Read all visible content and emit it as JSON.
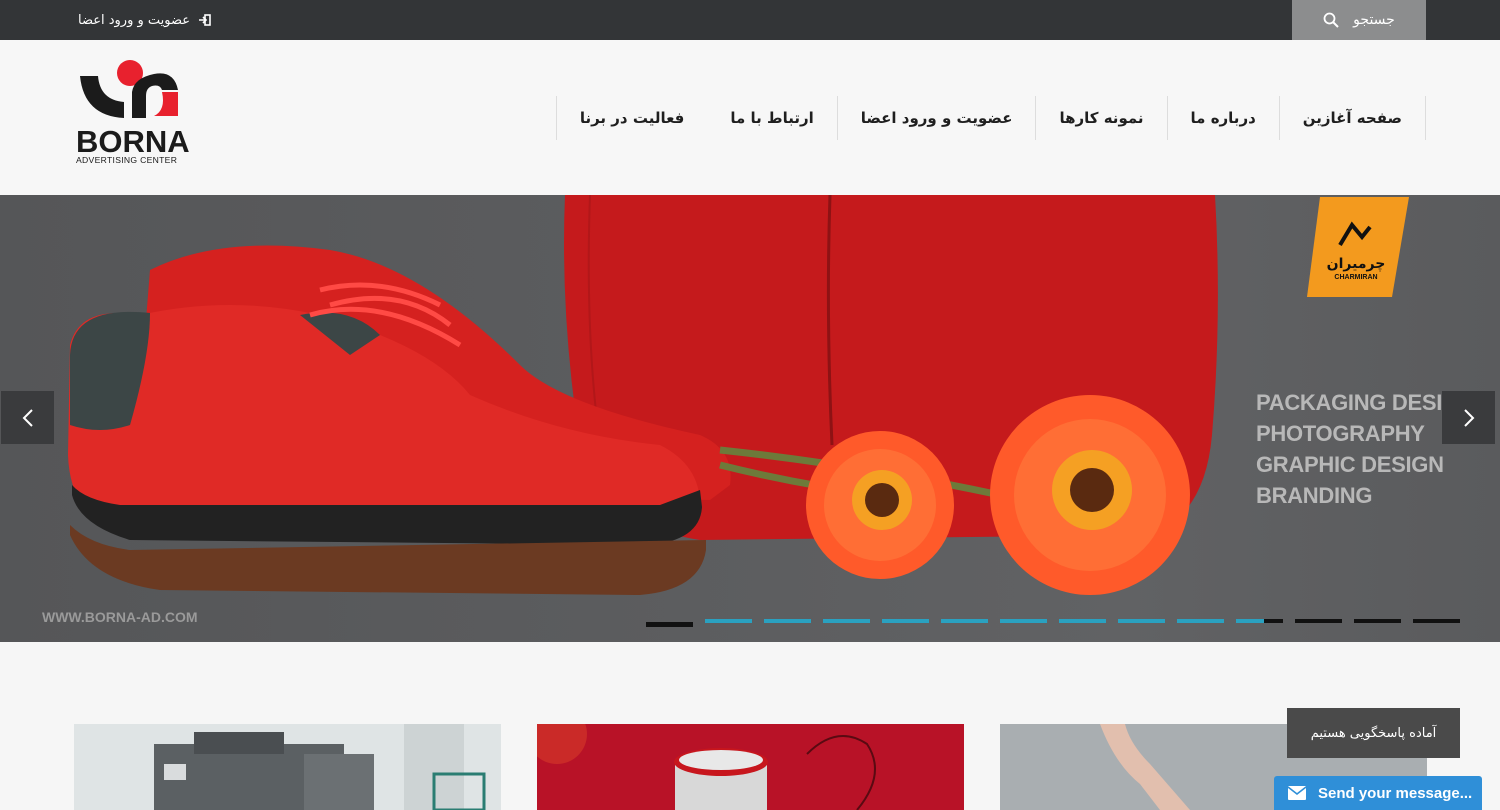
{
  "topbar": {
    "login_label": "عضویت و ورود اعضا",
    "search_label": "جستجو"
  },
  "logo": {
    "brand": "BORNA",
    "subtitle": "ADVERTISING CENTER"
  },
  "nav": {
    "items": [
      {
        "label": "صفحه آغازین"
      },
      {
        "label": "درباره ما"
      },
      {
        "label": "نمونه کارها"
      },
      {
        "label": "عضویت و ورود اعضا"
      },
      {
        "label": "ارتباط با ما"
      },
      {
        "label": "فعالیت در برنا"
      }
    ]
  },
  "slider": {
    "taglines": [
      "PACKAGING DESIGN",
      "PHOTOGRAPHY",
      "GRAPHIC DESIGN",
      "BRANDING"
    ],
    "watermark": "WWW.BORNA-AD.COM",
    "badge_fa": "چرمیران",
    "badge_en": "CHARMIRAN",
    "slide_count": 14,
    "active_index": 0
  },
  "chat": {
    "bubble_text": "آماده پاسخگویی هستیم",
    "bar_text": "Send your message..."
  },
  "colors": {
    "topbar": "#333537",
    "accent": "#2aa1c0",
    "logo_red": "#e8212e",
    "chat_blue": "#2f8fd8",
    "badge_orange": "#f39a1e"
  }
}
